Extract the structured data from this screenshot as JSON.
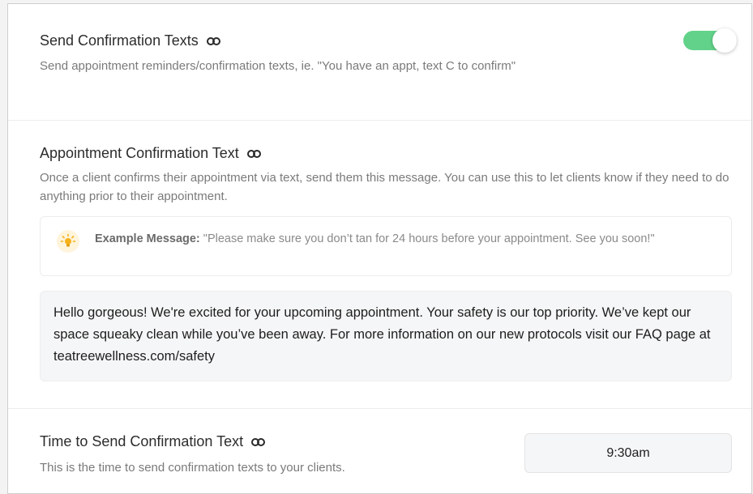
{
  "confirmation_texts": {
    "title": "Send Confirmation Texts",
    "description": "Send appointment reminders/confirmation texts, ie. \"You have an appt, text C to confirm\"",
    "toggle_on": true,
    "toggle_color": "#62d28a"
  },
  "appointment_confirmation": {
    "title": "Appointment Confirmation Text",
    "description": "Once a client confirms their appointment via text, send them this message. You can use this to let clients know if they need to do anything prior to their appointment.",
    "example_label": "Example Message:",
    "example_text": "\"Please make sure you don’t tan for 24 hours before your appointment. See you soon!\"",
    "message": "Hello gorgeous! We're excited for your upcoming appointment. Your safety is our top priority. We’ve kept our space squeaky clean while you’ve been away. For more information on our new protocols visit our FAQ page at teatreewellness.com/safety"
  },
  "send_time": {
    "title": "Time to Send Confirmation Text",
    "description": "This is the time to send confirmation texts to your clients.",
    "value": "9:30am"
  },
  "icons": {
    "link": "link-icon",
    "bulb": "lightbulb-icon"
  }
}
